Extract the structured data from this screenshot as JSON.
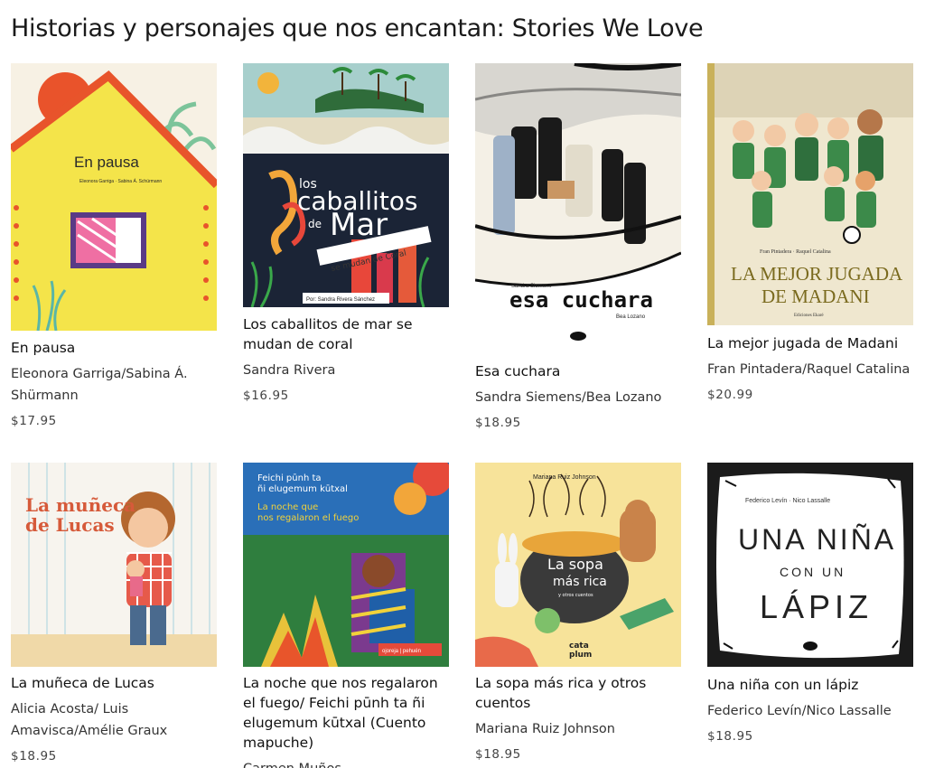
{
  "section": {
    "title": "Historias y personajes que nos encantan: Stories We Love"
  },
  "books": [
    {
      "title": "En pausa",
      "author": "Eleonora Garriga/Sabina Á. Shürmann",
      "price": "$17.95",
      "cover_text": "En pausa",
      "cover_sub": "Eleonora Garriga · Sabina Á. Schürmann"
    },
    {
      "title": "Los caballitos de mar se mudan de coral",
      "author": "Sandra Rivera",
      "price": "$16.95",
      "cover_text": "los caballitos de Mar",
      "cover_sub": "se mudan de Coral",
      "cover_by": "Por: Sandra Rivera Sánchez"
    },
    {
      "title": "Esa cuchara",
      "author": "Sandra Siemens/Bea Lozano",
      "price": "$18.95",
      "cover_text": "esa cuchara",
      "cover_author": "Sandra Siemens",
      "cover_illustrator": "Bea Lozano"
    },
    {
      "title": "La mejor jugada de Madani",
      "author": "Fran Pintadera/Raquel Catalina",
      "price": "$20.99",
      "cover_text_1": "LA MEJOR JUGADA",
      "cover_text_2": "DE MADANI",
      "cover_authors": "Fran Pintadera · Raquel Catalina",
      "cover_publisher": "Ediciones Ekaré"
    },
    {
      "title": "La muñeca de Lucas",
      "author": "Alicia Acosta/ Luis Amavisca/Amélie Graux",
      "price": "$18.95",
      "cover_text_1": "La muñeca",
      "cover_text_2": "de Lucas"
    },
    {
      "title": "La noche que nos regalaron el fuego/ Feichi pūnh ta ñi elugemum kūtxal (Cuento mapuche)",
      "author": "Carmen Muños",
      "price": "",
      "cover_text_1": "Feichi pūnh ta",
      "cover_text_2": "ñi elugemum kūtxal",
      "cover_text_3": "La noche que",
      "cover_text_4": "nos regalaron el fuego"
    },
    {
      "title": "La sopa más rica y otros cuentos",
      "author": "Mariana Ruiz Johnson",
      "price": "$18.95",
      "cover_author": "Mariana Ruiz Johnson",
      "cover_text_1": "La sopa",
      "cover_text_2": "más rica",
      "cover_text_3": "y otros cuentos"
    },
    {
      "title": "Una niña con un lápiz",
      "author": "Federico Levín/Nico Lassalle",
      "price": "$18.95",
      "cover_authors": "Federico Levín · Nico Lassalle",
      "cover_text_1": "UNA NIÑA",
      "cover_text_2": "CON UN",
      "cover_text_3": "LÁPIZ"
    }
  ]
}
